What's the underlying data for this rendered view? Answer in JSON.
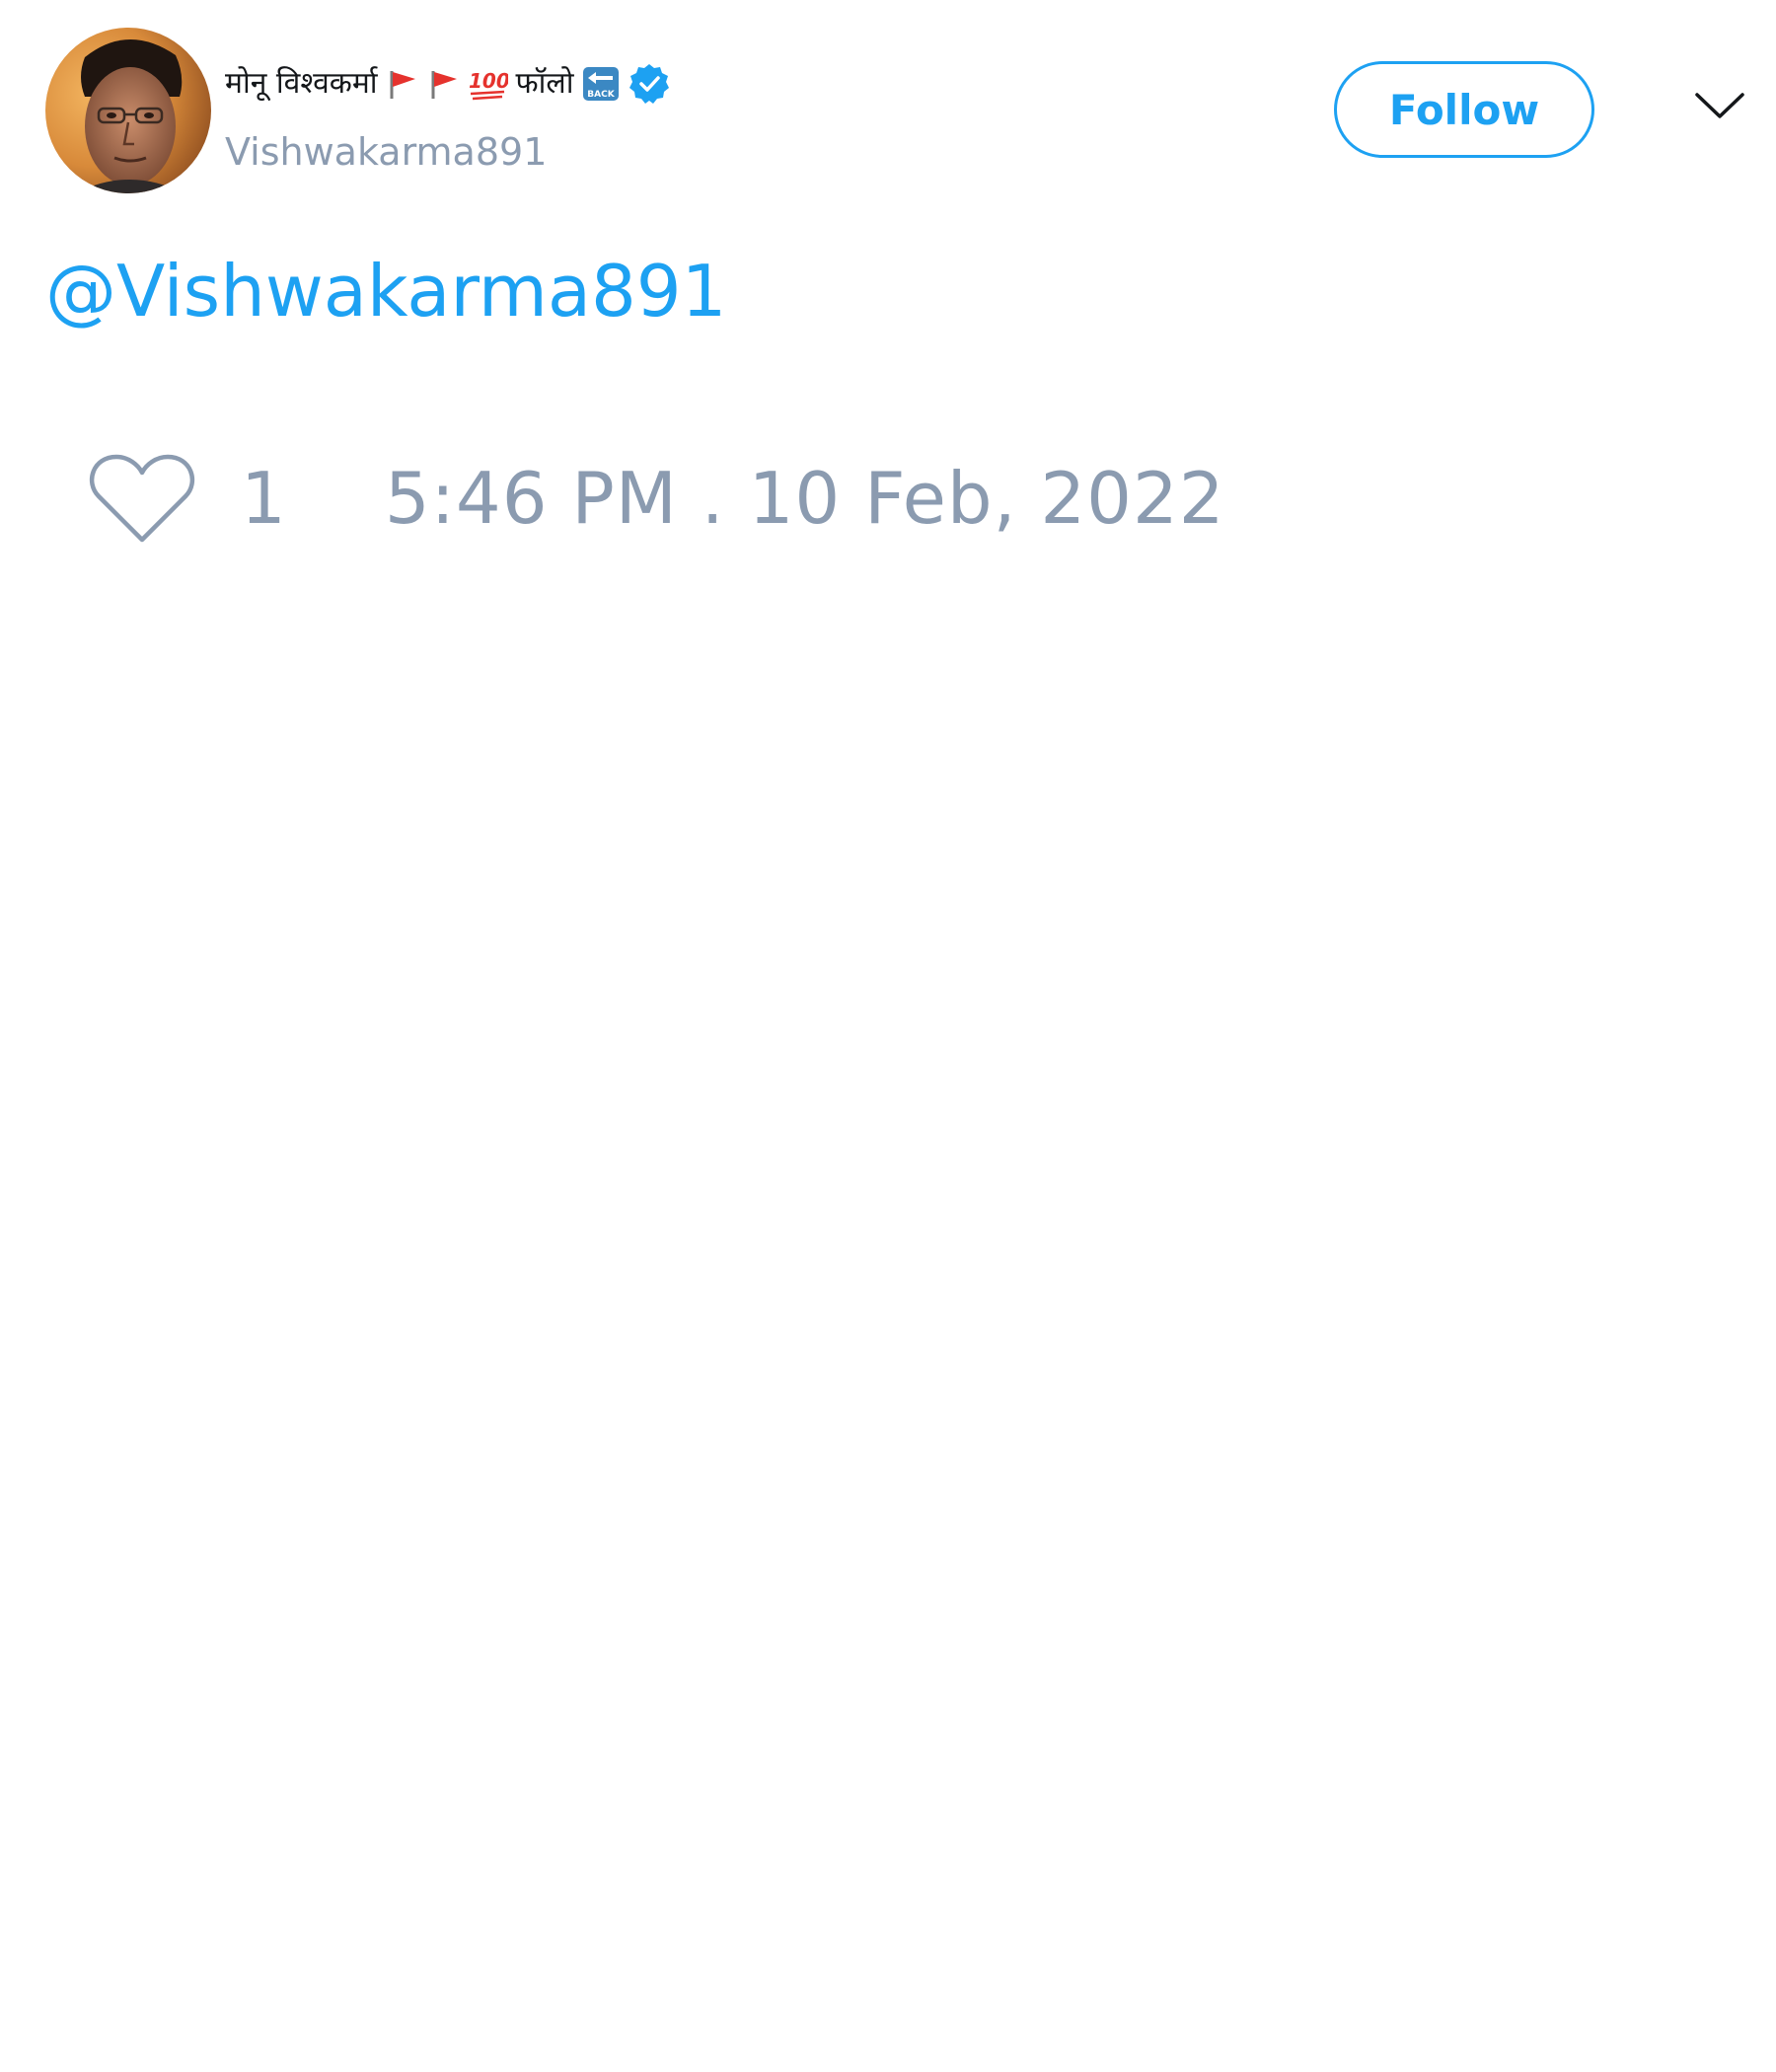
{
  "tweet": {
    "author": {
      "display_name": "मोनू विश्वकर्मा",
      "name_emojis": [
        "triangular-flag-icon",
        "triangular-flag-icon",
        "hundred-points-icon"
      ],
      "name_suffix_text": "फॉलो",
      "name_suffix_emoji": "back-arrow-icon",
      "verified_badge": "verified-badge-icon",
      "handle": "Vishwakarma891"
    },
    "follow_label": "Follow",
    "body_mention": "@Vishwakarma891",
    "like_count": "1",
    "timestamp": "5:46 PM . 10 Feb, 2022",
    "colors": {
      "accent": "#1da1f2",
      "muted": "#8b9bb0",
      "text": "#14171a"
    }
  }
}
